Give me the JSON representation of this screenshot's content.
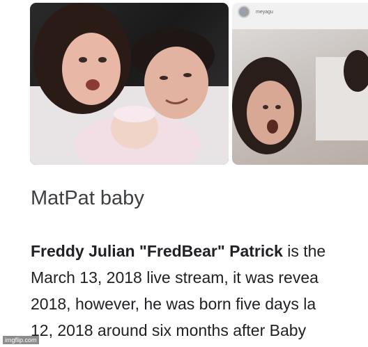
{
  "result": {
    "title": "MatPat baby",
    "source_name": "meyagu",
    "paragraph": {
      "subject": "Freddy Julian \"FredBear\" Patrick",
      "line1_rest": " is the",
      "line2": "March 13, 2018 live stream, it was revea",
      "line3": "2018, however, he was born five days la",
      "line4": "12, 2018 around six months after Baby"
    }
  },
  "watermark": "imgflip.com",
  "colors": {
    "title": "#3c4043",
    "text": "#202124",
    "background": "#ffffff"
  }
}
